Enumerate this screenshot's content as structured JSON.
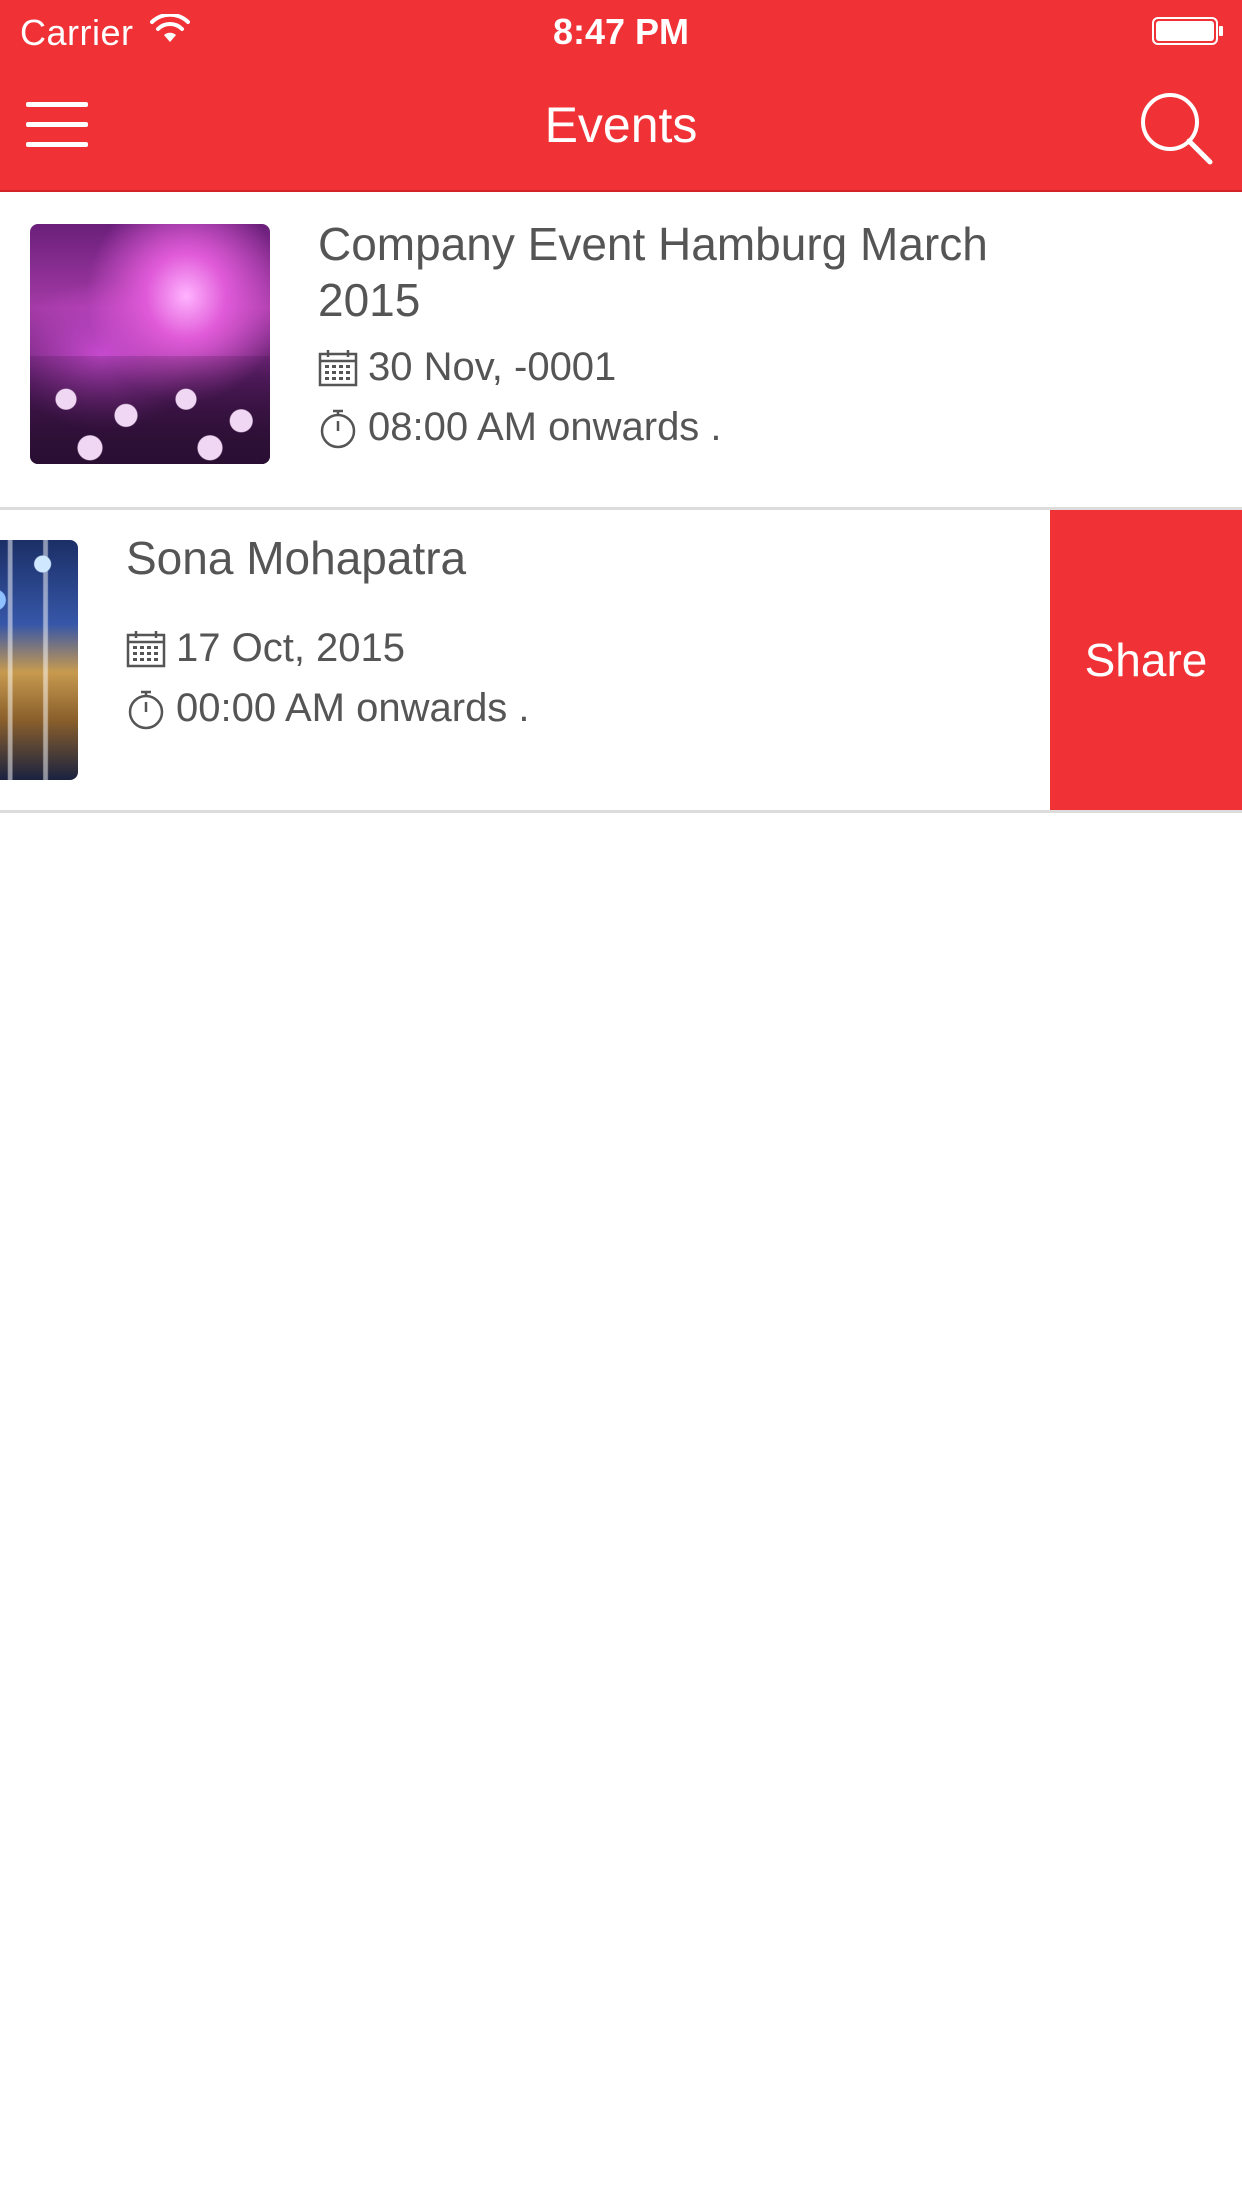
{
  "status_bar": {
    "carrier": "Carrier",
    "time": "8:47 PM"
  },
  "nav": {
    "title": "Events"
  },
  "colors": {
    "accent": "#f03237",
    "text": "#555555",
    "divider": "#dcdcdc"
  },
  "icons": [
    "menu-icon",
    "search-icon",
    "calendar-icon",
    "stopwatch-icon",
    "wifi-icon",
    "battery-icon"
  ],
  "events": [
    {
      "title": "Company Event Hamburg March 2015",
      "date": "30 Nov, -0001",
      "time": "08:00 AM onwards ."
    },
    {
      "title": "Sona Mohapatra",
      "date": "17 Oct, 2015",
      "time": "00:00 AM onwards .",
      "swipe_action": "Share"
    }
  ]
}
